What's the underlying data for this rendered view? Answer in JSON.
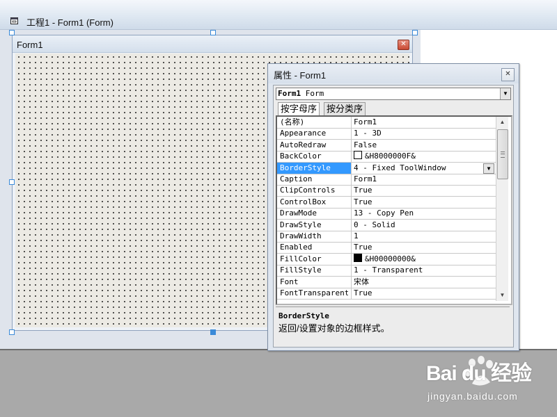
{
  "outer_window": {
    "title": "工程1 - Form1 (Form)",
    "icon": "form-window-icon"
  },
  "form1": {
    "title": "Form1",
    "close_icon": "close-icon"
  },
  "properties": {
    "title": "属性 - Form1",
    "close_icon": "close-icon",
    "object_combo": {
      "name": "Form1",
      "type": " Form"
    },
    "tabs": [
      {
        "label": "按字母序",
        "active": true
      },
      {
        "label": "按分类序",
        "active": false
      }
    ],
    "rows": [
      {
        "name": "(名称)",
        "value": "Form1"
      },
      {
        "name": "Appearance",
        "value": "1 - 3D"
      },
      {
        "name": "AutoRedraw",
        "value": "False"
      },
      {
        "name": "BackColor",
        "value": "&H8000000F&",
        "swatch": "#ffffff"
      },
      {
        "name": "BorderStyle",
        "value": "4 - Fixed ToolWindow",
        "selected": true,
        "dropdown": true
      },
      {
        "name": "Caption",
        "value": "Form1"
      },
      {
        "name": "ClipControls",
        "value": "True"
      },
      {
        "name": "ControlBox",
        "value": "True"
      },
      {
        "name": "DrawMode",
        "value": "13 - Copy Pen"
      },
      {
        "name": "DrawStyle",
        "value": "0 - Solid"
      },
      {
        "name": "DrawWidth",
        "value": "1"
      },
      {
        "name": "Enabled",
        "value": "True"
      },
      {
        "name": "FillColor",
        "value": "&H00000000&",
        "swatch": "#000000"
      },
      {
        "name": "FillStyle",
        "value": "1 - Transparent"
      },
      {
        "name": "Font",
        "value": "宋体"
      },
      {
        "name": "FontTransparent",
        "value": "True"
      }
    ],
    "description": {
      "title": "BorderStyle",
      "text": "返回/设置对象的边框样式。"
    }
  },
  "watermark": {
    "logo": "Bai du 经验",
    "site": "jingyan.baidu.com"
  },
  "colors": {
    "selection": "#3399ff",
    "handle": "#3a8ad8",
    "close_button": "#c94a33"
  }
}
